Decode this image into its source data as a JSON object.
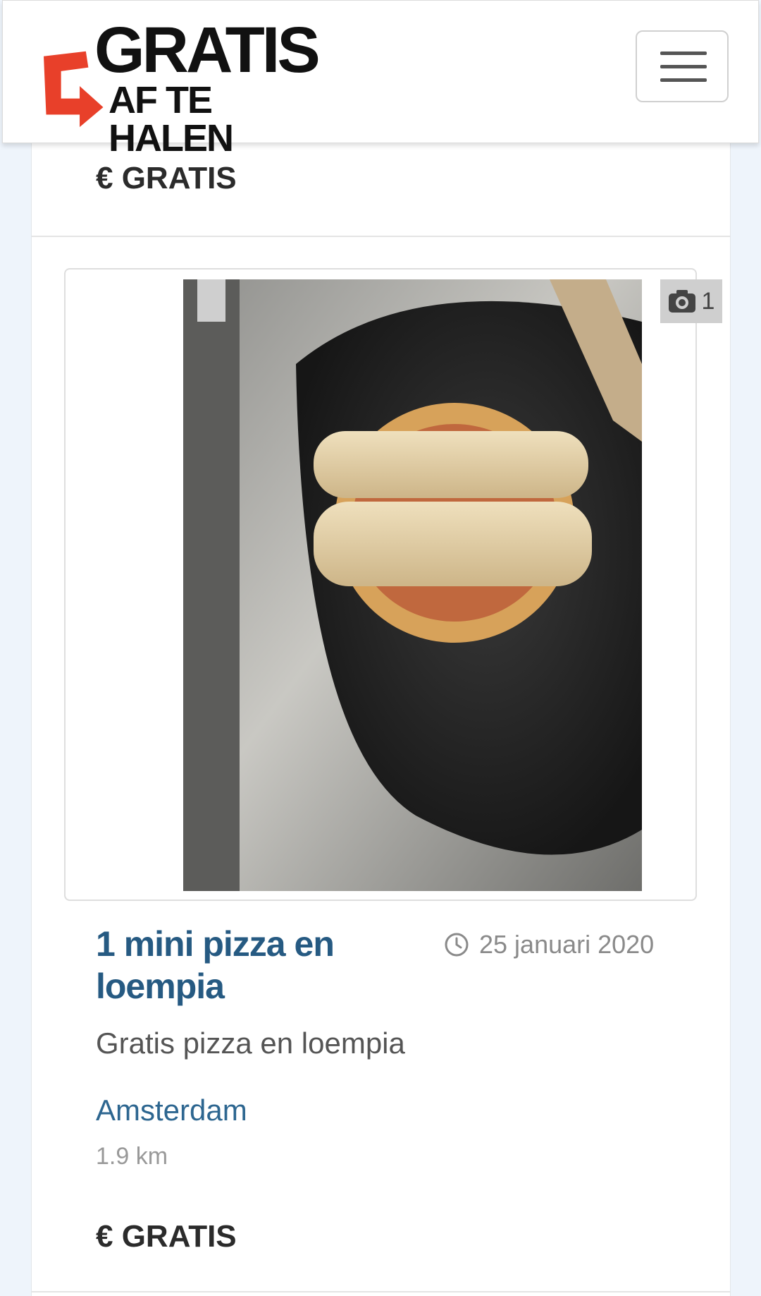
{
  "header": {
    "logo_line1": "GRATIS",
    "logo_line2": "AF TE HALEN",
    "menu_icon": "hamburger-menu-icon",
    "brand_color": "#e8402a"
  },
  "previous_listing": {
    "price": "€ GRATIS"
  },
  "listing": {
    "photo_count": "1",
    "photo_icon": "camera-icon",
    "title": "1 mini pizza en loempia",
    "date_icon": "clock-icon",
    "date": "25 januari 2020",
    "description": "Gratis pizza en loempia",
    "city": "Amsterdam",
    "distance": "1.9 km",
    "price": "€ GRATIS"
  },
  "colors": {
    "title": "#265a82",
    "city": "#2d6690",
    "page_background": "#eef4fb"
  }
}
